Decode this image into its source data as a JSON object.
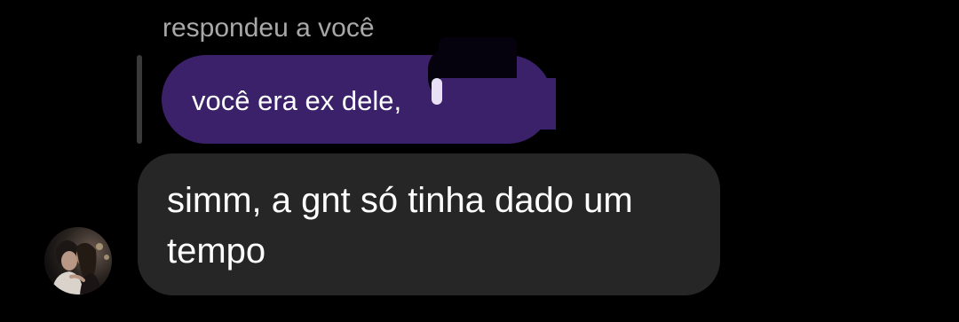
{
  "reply_header": {
    "caption": "respondeu a você"
  },
  "quoted_message": {
    "text": "você era ex dele,"
  },
  "reply_message": {
    "lines": [
      "simm, a gnt só tinha dado um",
      "tempo"
    ]
  },
  "sender": {
    "avatar_icon": "avatar-photo"
  },
  "colors": {
    "background": "#000000",
    "quoted_bubble": "#3a2169",
    "reply_bubble": "#262626",
    "caption_text": "#a8a8a8",
    "message_text": "#ffffff"
  }
}
